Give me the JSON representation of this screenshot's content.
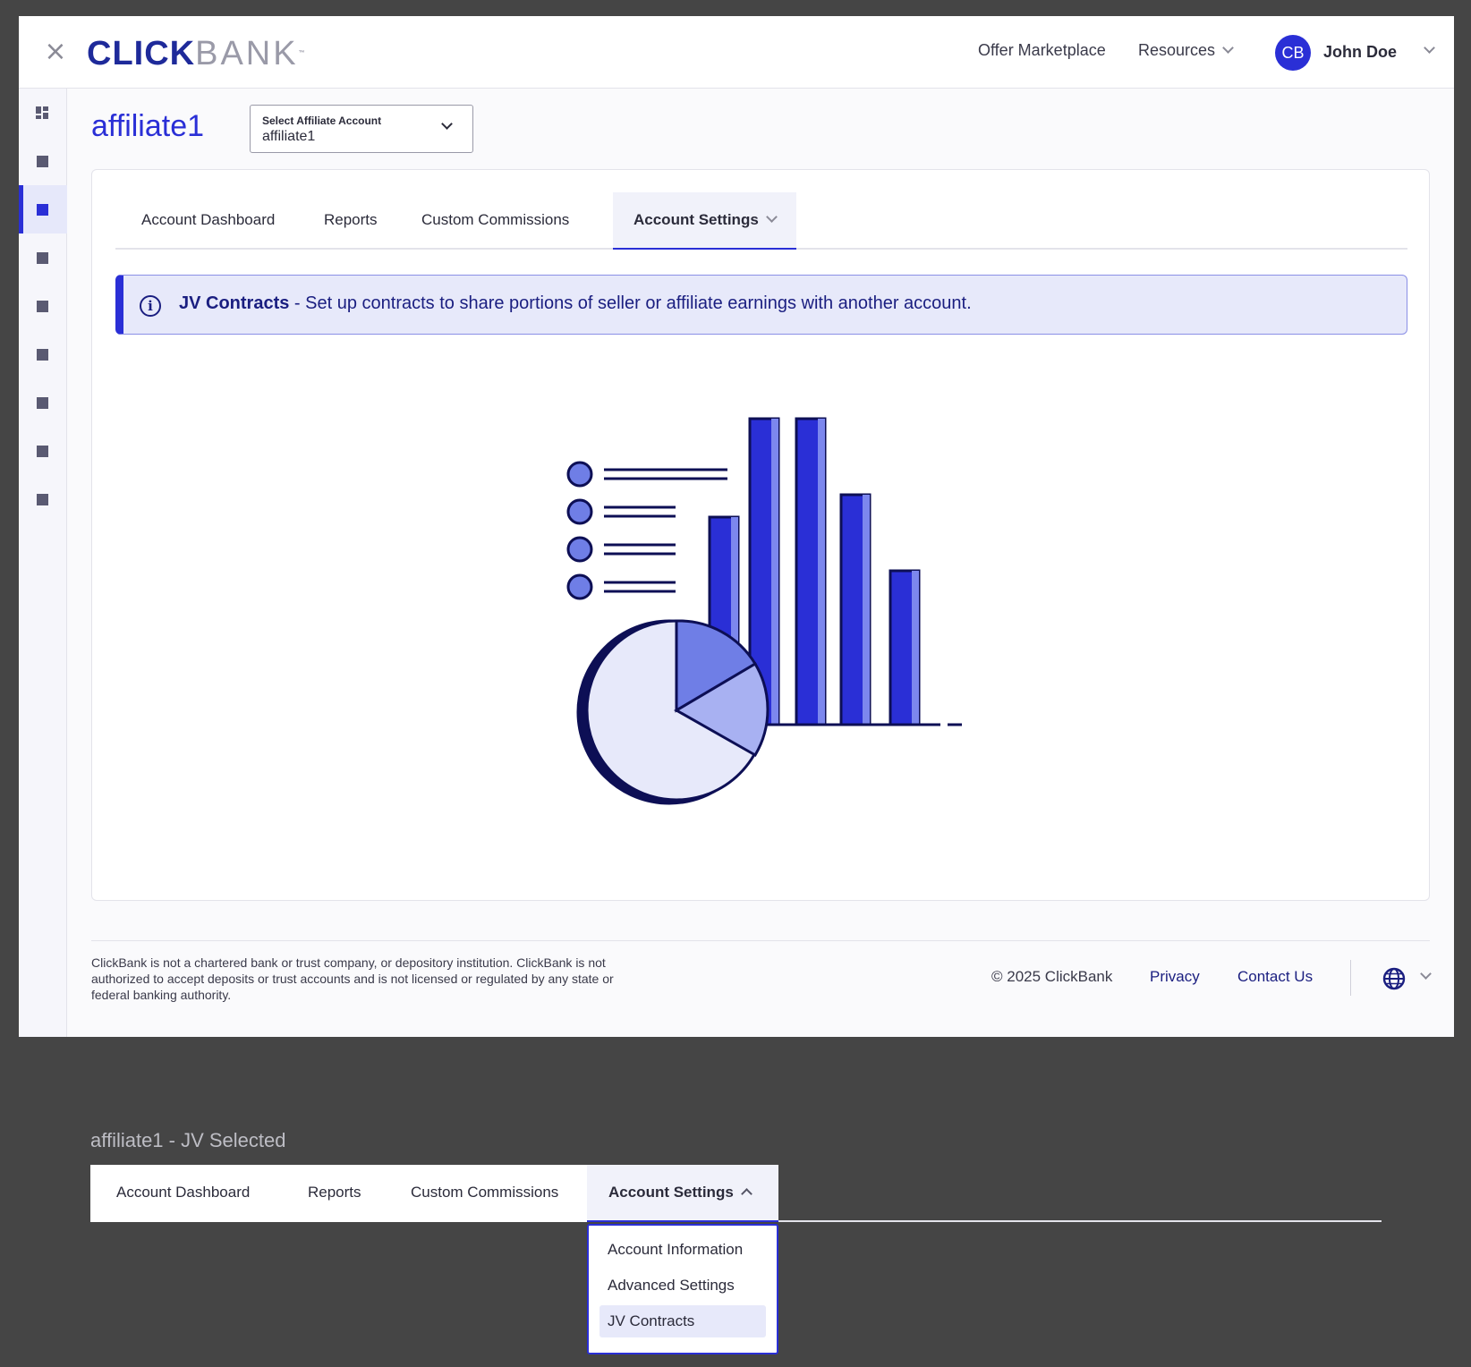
{
  "header": {
    "logo_part1": "CLICK",
    "logo_part2": "BANK",
    "logo_tm": "™",
    "nav": [
      "Offer Marketplace",
      "Resources"
    ],
    "avatar_initials": "CB",
    "user_name": "John Doe"
  },
  "account": {
    "title": "affiliate1",
    "select_label": "Select Affiliate Account",
    "select_value": "affiliate1"
  },
  "tabs": [
    "Account Dashboard",
    "Reports",
    "Custom Commissions",
    "Account Settings"
  ],
  "active_tab": "Account Settings",
  "banner": {
    "title": "JV Contracts",
    "text": " - Set up contracts to share portions of seller or affiliate earnings with another account."
  },
  "footer": {
    "disclaimer": "ClickBank is not a chartered bank or trust company, or depository institution. ClickBank is not authorized to accept deposits or trust accounts and is not licensed or regulated by any state or federal banking authority.",
    "copyright": "© 2025 ClickBank",
    "links": [
      "Privacy",
      "Contact Us"
    ]
  },
  "lower_panel": {
    "caption": "affiliate1 - JV Selected",
    "tabs": [
      "Account Dashboard",
      "Reports",
      "Custom Commissions",
      "Account Settings"
    ],
    "dropdown_items": [
      "Account Information",
      "Advanced Settings",
      "JV Contracts"
    ],
    "selected_item": "JV Contracts"
  },
  "colors": {
    "brand": "#2a2fd6",
    "brand_dark": "#1a1e80",
    "banner_bg": "#e7e9fa"
  }
}
